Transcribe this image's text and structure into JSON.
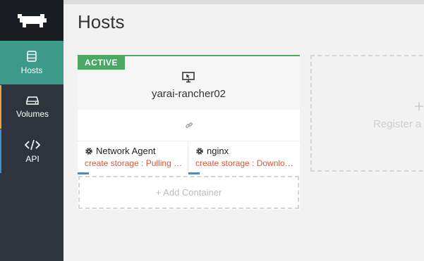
{
  "sidebar": {
    "logo_icon": "rancher-cow-icon",
    "items": [
      {
        "label": "Hosts",
        "icon": "server-icon"
      },
      {
        "label": "Volumes",
        "icon": "hard-drive-icon"
      },
      {
        "label": "API",
        "icon": "code-icon"
      }
    ]
  },
  "page": {
    "title": "Hosts"
  },
  "host": {
    "state": "ACTIVE",
    "name": "yarai-rancher02",
    "icon": "monitor-icon",
    "link_icon": "link-icon",
    "containers": [
      {
        "name": "Network Agent",
        "status": "create storage : Pulling image",
        "icon": "gear-icon"
      },
      {
        "name": "nginx",
        "status": "create storage : Downloading",
        "icon": "gear-icon"
      }
    ],
    "add_container": "+ Add Container"
  },
  "register": {
    "plus": "+",
    "label": "Register a"
  },
  "colors": {
    "sidebar_bg": "#2e343d",
    "active_nav": "#3d9a8b",
    "active_badge": "#4aa864",
    "status_text": "#d6573c",
    "volumes_accent": "#f0a33d",
    "api_accent": "#3c8fd1"
  }
}
